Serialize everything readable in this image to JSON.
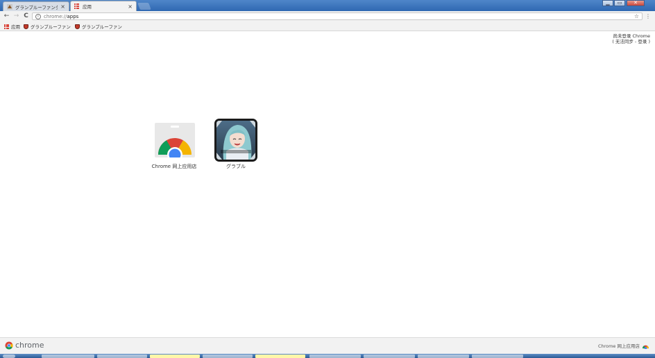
{
  "tabs": [
    {
      "label": "グランブルーファンタジ",
      "active": false
    },
    {
      "label": "应用",
      "active": true
    }
  ],
  "tab_close_glyph": "×",
  "window_controls": {
    "minimize": "▁",
    "maximize": "▭",
    "close": "✕"
  },
  "toolbar": {
    "back": "←",
    "forward": "→",
    "reload": "C",
    "url_scheme": "chrome://",
    "url_rest": "apps",
    "bookmark_star": "☆",
    "menu": "⋮"
  },
  "bookmarks": [
    {
      "label": "应用",
      "icon": "apps-grid-icon"
    },
    {
      "label": "グランブルーファン",
      "icon": "shield-icon"
    },
    {
      "label": "グランブルーファン",
      "icon": "shield-icon"
    }
  ],
  "signin": {
    "line1": "尚未登录 Chrome",
    "line2": "( 无法同步 - 登录 )"
  },
  "apps": [
    {
      "label": "Chrome 网上应用店",
      "icon": "chrome-web-store-icon"
    },
    {
      "label": "グラブル",
      "icon": "granblue-app-icon"
    }
  ],
  "bottom": {
    "brand": "chrome",
    "webstore_link": "Chrome 网上应用店"
  },
  "colors": {
    "chrome_red": "#db4437",
    "chrome_yellow": "#f4b400",
    "chrome_green": "#0f9d58",
    "chrome_blue": "#4285f4",
    "titlebar": "#2f68b2"
  }
}
